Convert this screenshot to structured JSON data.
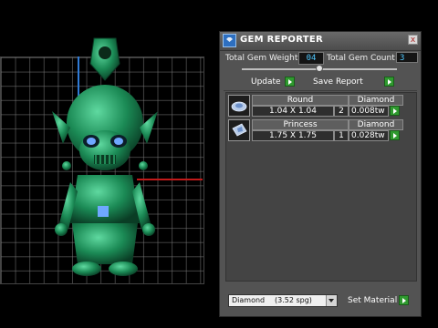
{
  "panel": {
    "title": "GEM REPORTER",
    "close_glyph": "x",
    "total_weight_label": "Total Gem Weight",
    "total_weight_value": "04",
    "total_count_label": "Total Gem Count",
    "total_count_value": "3",
    "update_label": "Update",
    "save_label": "Save Report",
    "set_material_label": "Set Material"
  },
  "gems": [
    {
      "shape": "Round",
      "size": "1.04 X 1.04",
      "qty": "2",
      "material": "Diamond",
      "weight": "0.008tw",
      "icon": "round-gem-icon"
    },
    {
      "shape": "Princess",
      "size": "1.75 X 1.75",
      "qty": "1",
      "material": "Diamond",
      "weight": "0.028tw",
      "icon": "princess-gem-icon"
    }
  ],
  "material_select": {
    "name": "Diamond",
    "sg": "(3.52 spg)"
  },
  "colors": {
    "panel": "#535353",
    "model": "#1f8a55",
    "value_text": "#4fc8ff",
    "go_button": "#2f9a2f"
  }
}
